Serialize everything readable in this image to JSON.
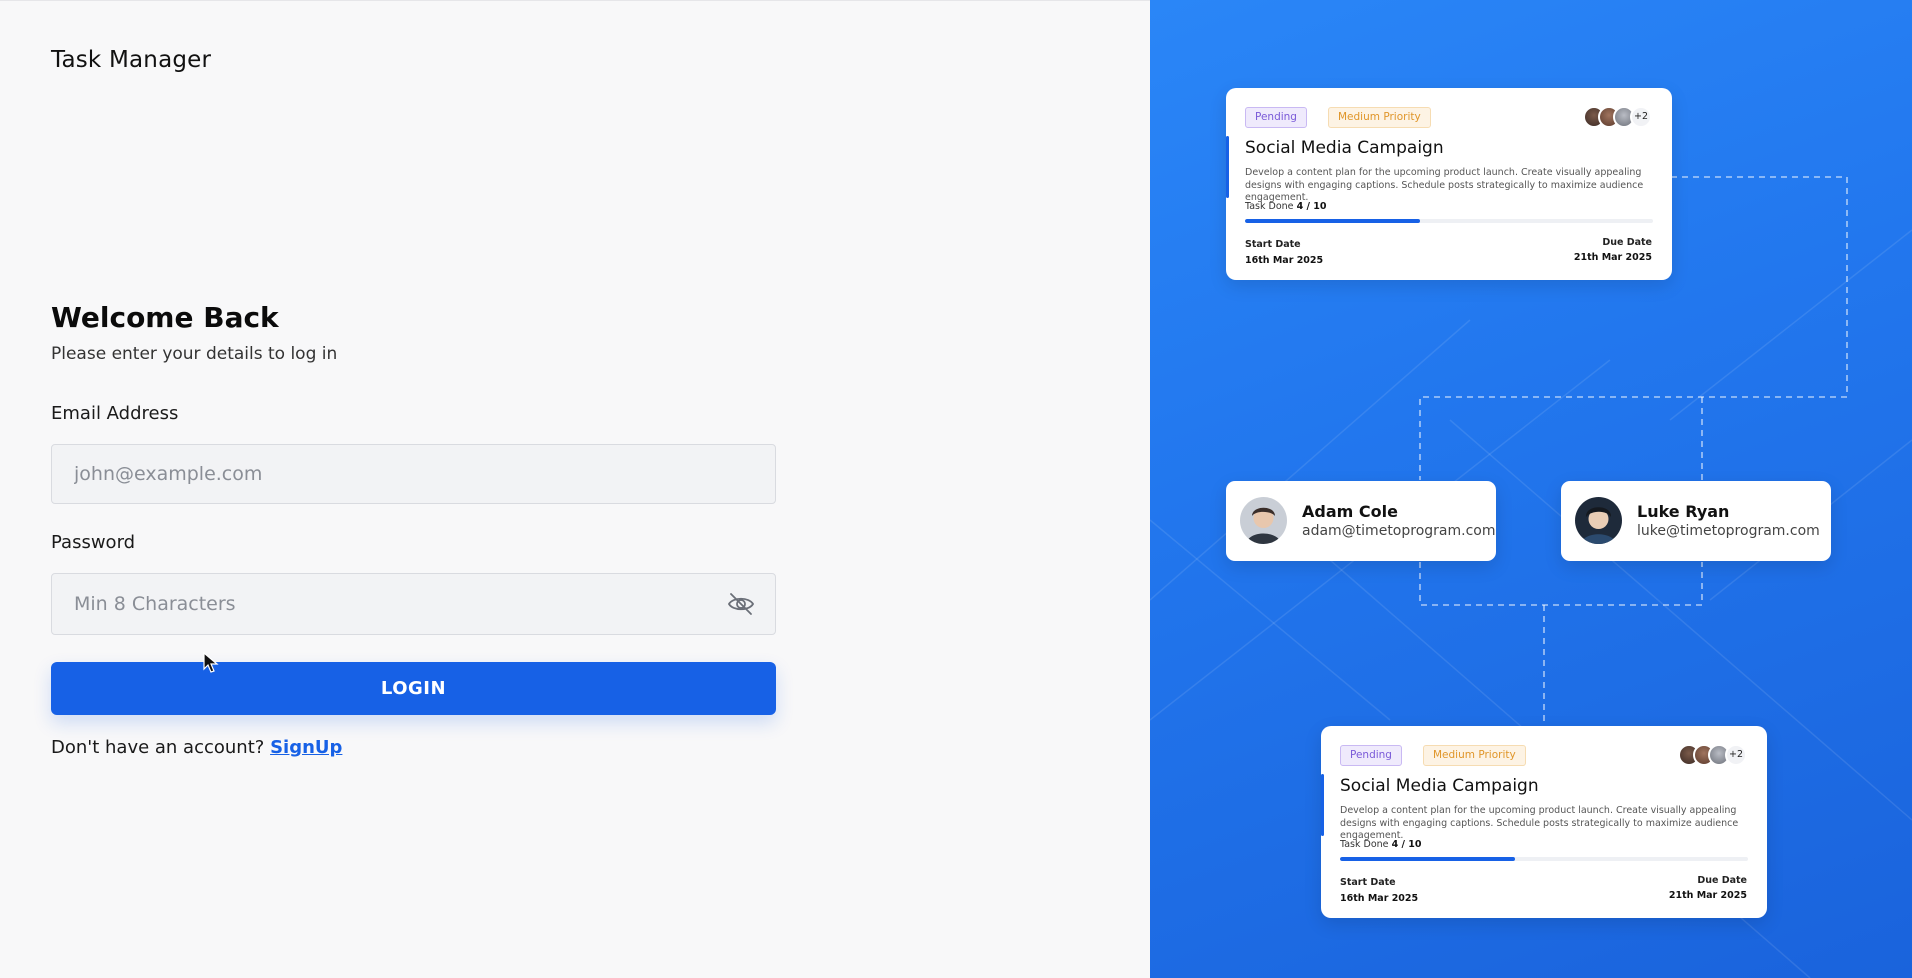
{
  "app": {
    "title": "Task Manager"
  },
  "login": {
    "heading": "Welcome Back",
    "subtitle": "Please enter your details to log in",
    "email_label": "Email Address",
    "email_placeholder": "john@example.com",
    "password_label": "Password",
    "password_placeholder": "Min 8 Characters",
    "login_button": "LOGIN",
    "signup_prompt": "Don't have an account?",
    "signup_link": "SignUp"
  },
  "icons": {
    "password_toggle": "eye-off-icon",
    "cursor": "mouse-pointer-icon"
  },
  "colors": {
    "primary": "#1761e6",
    "panel_bg_start": "#2a86f7",
    "panel_bg_end": "#1a63dc",
    "pending": "#7a5ad8",
    "priority": "#e0962a"
  },
  "tasks": [
    {
      "status": "Pending",
      "priority": "Medium Priority",
      "more_assignees": "+2",
      "title": "Social Media Campaign",
      "description": "Develop a content plan for the upcoming product launch. Create visually appealing designs with engaging captions. Schedule posts strategically to maximize audience engagement.",
      "task_done_label": "Task Done",
      "task_done_value": "4 / 10",
      "progress": 0.43,
      "start_label": "Start Date",
      "start_date": "16th Mar 2025",
      "due_label": "Due Date",
      "due_date": "21th Mar 2025"
    },
    {
      "status": "Pending",
      "priority": "Medium Priority",
      "more_assignees": "+2",
      "title": "Social Media Campaign",
      "description": "Develop a content plan for the upcoming product launch. Create visually appealing designs with engaging captions. Schedule posts strategically to maximize audience engagement.",
      "task_done_label": "Task Done",
      "task_done_value": "4 / 10",
      "progress": 0.43,
      "start_label": "Start Date",
      "start_date": "16th Mar 2025",
      "due_label": "Due Date",
      "due_date": "21th Mar 2025"
    }
  ],
  "users": [
    {
      "name": "Adam Cole",
      "email": "adam@timetoprogram.com"
    },
    {
      "name": "Luke Ryan",
      "email": "luke@timetoprogram.com"
    }
  ]
}
